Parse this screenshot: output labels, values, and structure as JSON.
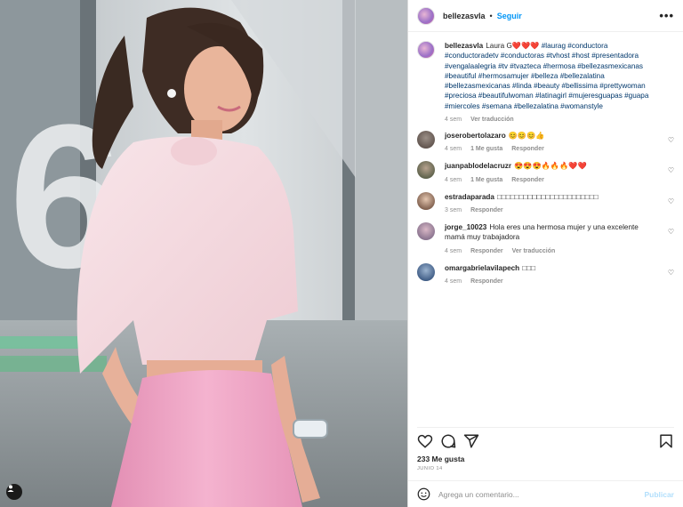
{
  "post": {
    "username": "bellezasvla",
    "follow_label": "Seguir",
    "more_icon": "more-options-icon",
    "caption_user": "bellezasvla",
    "caption_text": "Laura G",
    "caption_hearts": "❤️❤️❤️",
    "caption_tags": "#laurag #conductora #conductoradetv #conductoras #tvhost #host #presentadora #vengalaalegria #tv #tvazteca #hermosa #bellezasmexicanas #beautiful #hermosamujer #belleza #bellezalatina #bellezasmexicanas #linda #beauty #bellissima #prettywoman #preciosa #beautifulwoman #latinagirl #mujeresguapas #guapa #miercoles #semana #bellezalatina #womanstyle",
    "caption_time": "4 sem",
    "caption_translate": "Ver traducción",
    "likes": "233 Me gusta",
    "date": "JUNIO 14",
    "comment_placeholder": "Agrega un comentario...",
    "publish_label": "Publicar"
  },
  "comments": [
    {
      "user": "joserobertolazaro",
      "text": "😊😊😊👍",
      "time": "4 sem",
      "likes": "1 Me gusta",
      "reply": "Responder",
      "translate": ""
    },
    {
      "user": "juanpablodelacruzr",
      "text": "😍😍😍🔥🔥🔥❤️❤️",
      "time": "4 sem",
      "likes": "1 Me gusta",
      "reply": "Responder",
      "translate": ""
    },
    {
      "user": "estradaparada",
      "text": "□□□□□□□□□□□□□□□□□□□□□□□",
      "time": "3 sem",
      "likes": "",
      "reply": "Responder",
      "translate": ""
    },
    {
      "user": "jorge_10023",
      "text": "Hola eres una hermosa mujer y una excelente mamá muy trabajadora",
      "time": "4 sem",
      "likes": "",
      "reply": "Responder",
      "translate": "Ver traducción"
    },
    {
      "user": "omargabrielavilapech",
      "text": "□□□",
      "time": "4 sem",
      "likes": "",
      "reply": "Responder",
      "translate": ""
    }
  ],
  "colors": {
    "accent": "#0095f6",
    "publish_disabled": "#b2dffc",
    "skirt": "#f2a7c6",
    "blouse": "#f6dde3"
  }
}
